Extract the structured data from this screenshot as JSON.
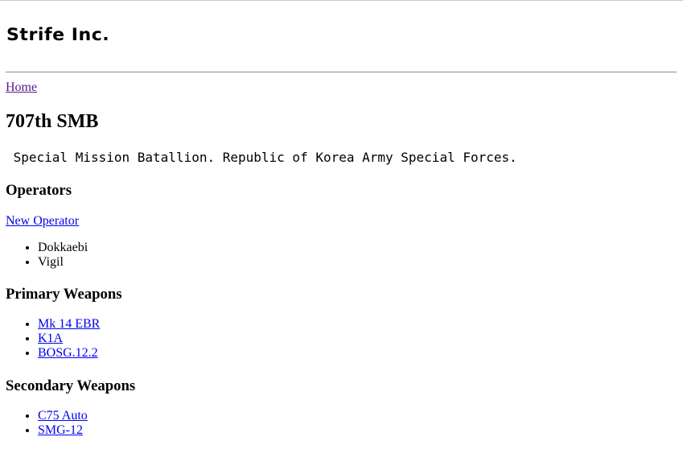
{
  "header": {
    "logo_text": "Strife Inc."
  },
  "breadcrumb": {
    "home_label": "Home"
  },
  "unit": {
    "title": "707th SMB",
    "description": " Special Mission Batallion. Republic of Korea Army Special Forces."
  },
  "operators": {
    "heading": "Operators",
    "new_operator_label": "New Operator",
    "items": [
      "Dokkaebi",
      "Vigil"
    ]
  },
  "primary_weapons": {
    "heading": "Primary Weapons",
    "items": [
      "Mk 14 EBR",
      "K1A",
      "BOSG.12.2"
    ]
  },
  "secondary_weapons": {
    "heading": "Secondary Weapons",
    "items": [
      "C75 Auto",
      "SMG-12"
    ]
  }
}
